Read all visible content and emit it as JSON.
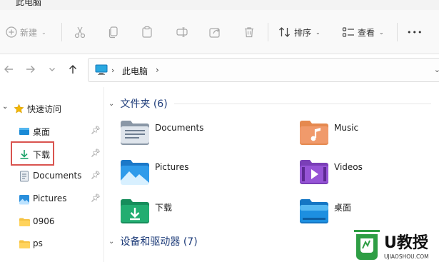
{
  "window": {
    "title": "此电脑"
  },
  "toolbar": {
    "new_label": "新建",
    "sort_label": "排序",
    "view_label": "查看",
    "more_label": "•••",
    "icons": [
      "cut-icon",
      "copy-icon",
      "paste-icon",
      "rename-icon",
      "share-icon",
      "delete-icon"
    ]
  },
  "address": {
    "path": "此电脑"
  },
  "sidebar": {
    "quick_access": "快速访问",
    "items": [
      {
        "label": "桌面",
        "icon": "desktop-icon",
        "pinned": true
      },
      {
        "label": "下载",
        "icon": "download-icon",
        "pinned": true
      },
      {
        "label": "Documents",
        "icon": "documents-icon",
        "pinned": true
      },
      {
        "label": "Pictures",
        "icon": "pictures-icon",
        "pinned": true
      },
      {
        "label": "0906",
        "icon": "folder-icon",
        "pinned": false
      },
      {
        "label": "ps",
        "icon": "folder-icon",
        "pinned": false
      }
    ]
  },
  "main": {
    "folders_header": "文件夹 (6)",
    "folders": [
      {
        "name": "Documents",
        "icon": "documents-folder-icon"
      },
      {
        "name": "Music",
        "icon": "music-folder-icon"
      },
      {
        "name": "Pictures",
        "icon": "pictures-folder-icon"
      },
      {
        "name": "Videos",
        "icon": "videos-folder-icon"
      },
      {
        "name": "下载",
        "icon": "downloads-folder-icon"
      },
      {
        "name": "桌面",
        "icon": "desktop-folder-icon"
      }
    ],
    "devices_header": "设备和驱动器 (7)"
  },
  "watermark": {
    "brand": "U教授",
    "url": "UJIAOSHOU.COM"
  },
  "colors": {
    "accent_blue": "#1a73c9",
    "download_green": "#1ea36a",
    "highlight_red": "#d9534f",
    "folder_yellow": "#f5c242",
    "watermark_green": "#2e9e44"
  }
}
